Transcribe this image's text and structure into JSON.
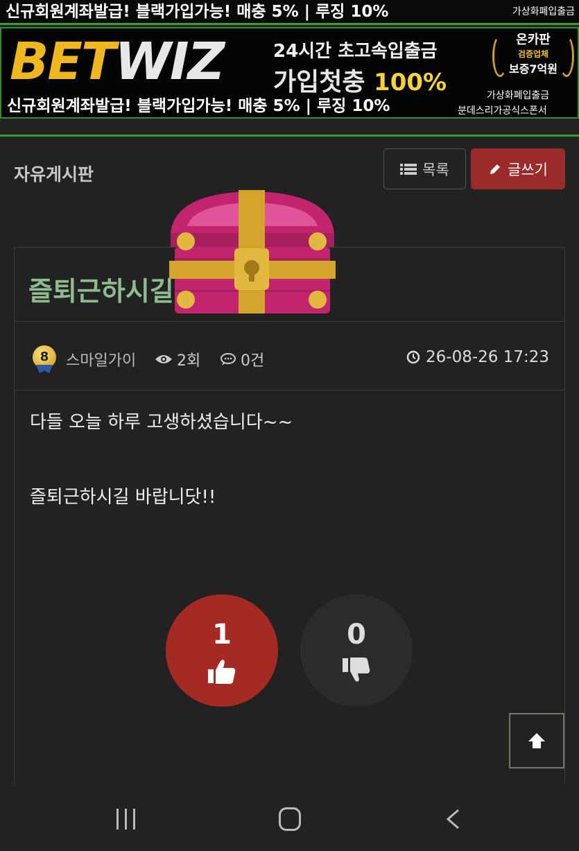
{
  "banner": {
    "top_promo": "신규회원계좌발급! 블랙가입가능! 매충 5% | 루징 10%",
    "top_sub": "가상화폐입출금",
    "logo_bet": "BET",
    "logo_wiz": "WIZ",
    "headline1": "24시간 초고속입출금",
    "headline2_text": "가입첫충",
    "headline2_pct": "100%",
    "badge_line1": "온카판",
    "badge_line2": "검증업체",
    "badge_line3": "보증7억원",
    "bottom_promo": "신규회원계좌발급! 블랙가입가능! 매충 5% | 루징 10%",
    "sub1": "가상화폐입출금",
    "sub2": "분데스리가공식스폰서"
  },
  "board": {
    "title": "자유게시판",
    "list_button": "목록",
    "write_button": "글쓰기"
  },
  "post": {
    "title": "즐퇴근하시길",
    "level": "8",
    "author": "스마일가이",
    "views": "2회",
    "comments": "0건",
    "date": "26-08-26 17:23",
    "body": [
      "다들 오늘 하루 고생하셨습니다~~",
      "즐퇴근하시길 바랍니닷!!"
    ]
  },
  "votes": {
    "up": "1",
    "down": "0"
  },
  "colors": {
    "accent_red": "#9b2a2a",
    "green_border": "#3a9a3a",
    "title_green": "#8fbc8f"
  }
}
